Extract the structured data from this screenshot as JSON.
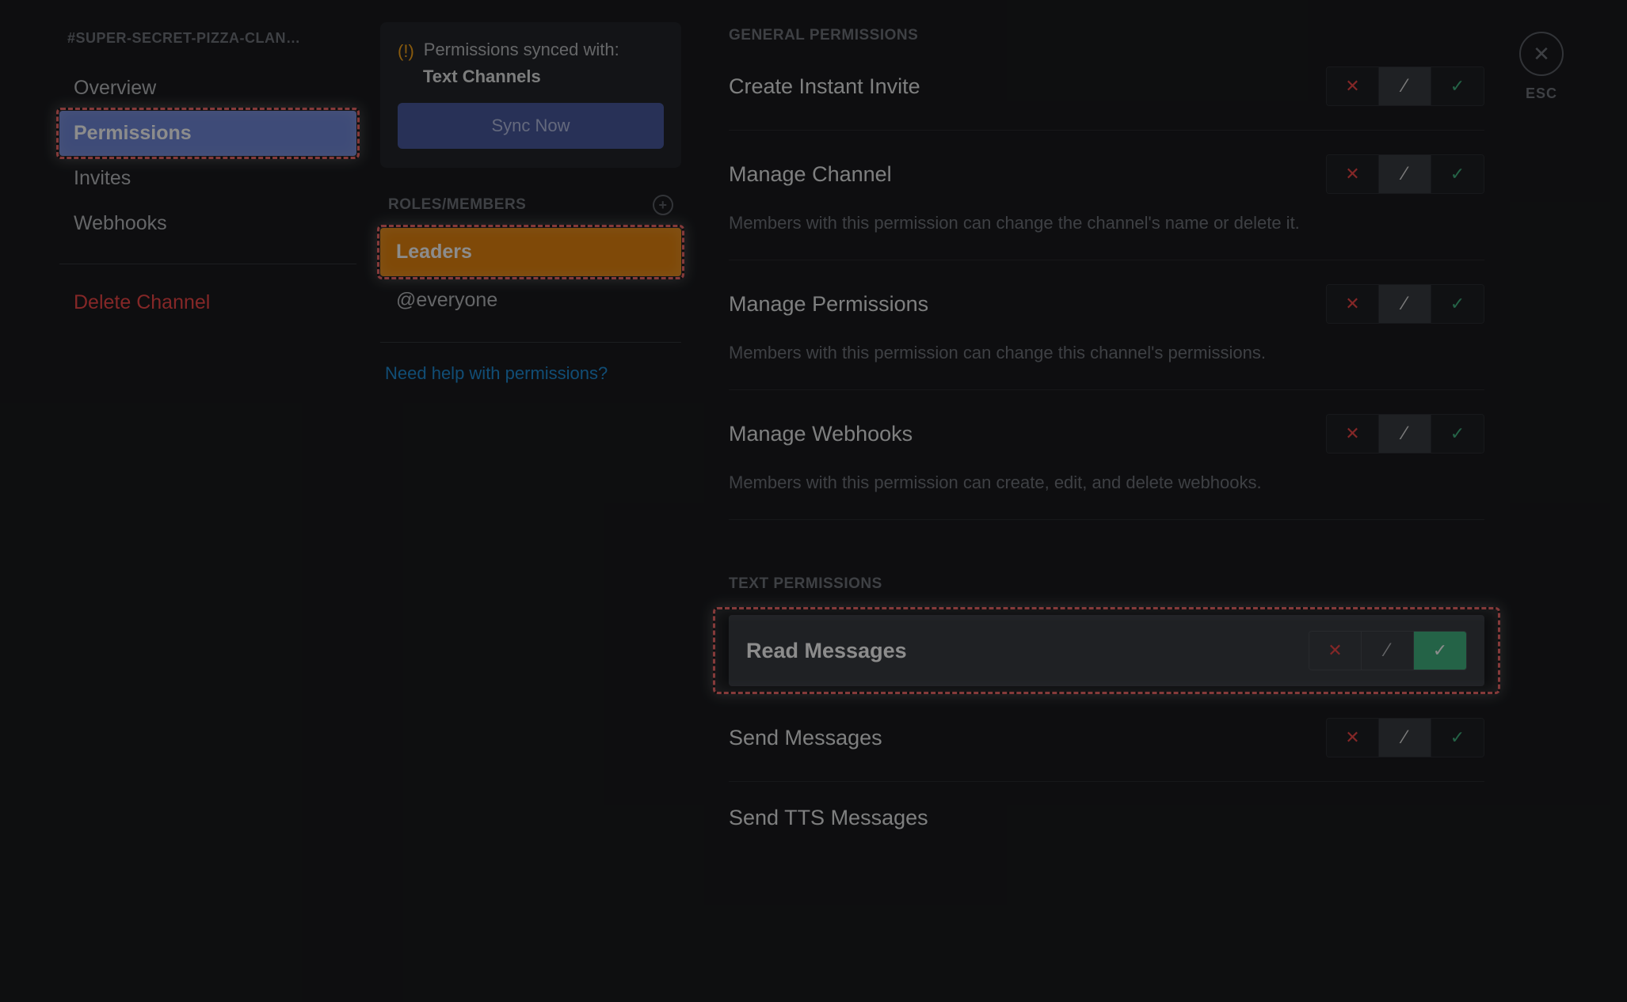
{
  "sidebar": {
    "title": "#SUPER-SECRET-PIZZA-CLAN…",
    "items": [
      "Overview",
      "Permissions",
      "Invites",
      "Webhooks"
    ],
    "delete_label": "Delete Channel"
  },
  "sync": {
    "text": "Permissions synced with:",
    "category": "Text Channels",
    "button": "Sync Now"
  },
  "roles": {
    "header": "ROLES/MEMBERS",
    "items": [
      "Leaders",
      "@everyone"
    ],
    "help": "Need help with permissions?"
  },
  "sections": [
    {
      "title": "GENERAL PERMISSIONS",
      "perms": [
        {
          "name": "Create Instant Invite",
          "desc": "",
          "state": "neutral"
        },
        {
          "name": "Manage Channel",
          "desc": "Members with this permission can change the channel's name or delete it.",
          "state": "neutral"
        },
        {
          "name": "Manage Permissions",
          "desc": "Members with this permission can change this channel's permissions.",
          "state": "neutral"
        },
        {
          "name": "Manage Webhooks",
          "desc": "Members with this permission can create, edit, and delete webhooks.",
          "state": "neutral"
        }
      ]
    },
    {
      "title": "TEXT PERMISSIONS",
      "perms": [
        {
          "name": "Read Messages",
          "desc": "",
          "state": "allow",
          "highlight": true
        },
        {
          "name": "Send Messages",
          "desc": "",
          "state": "neutral"
        },
        {
          "name": "Send TTS Messages",
          "desc": "",
          "state": "neutral"
        }
      ]
    }
  ],
  "close": {
    "label": "ESC"
  }
}
